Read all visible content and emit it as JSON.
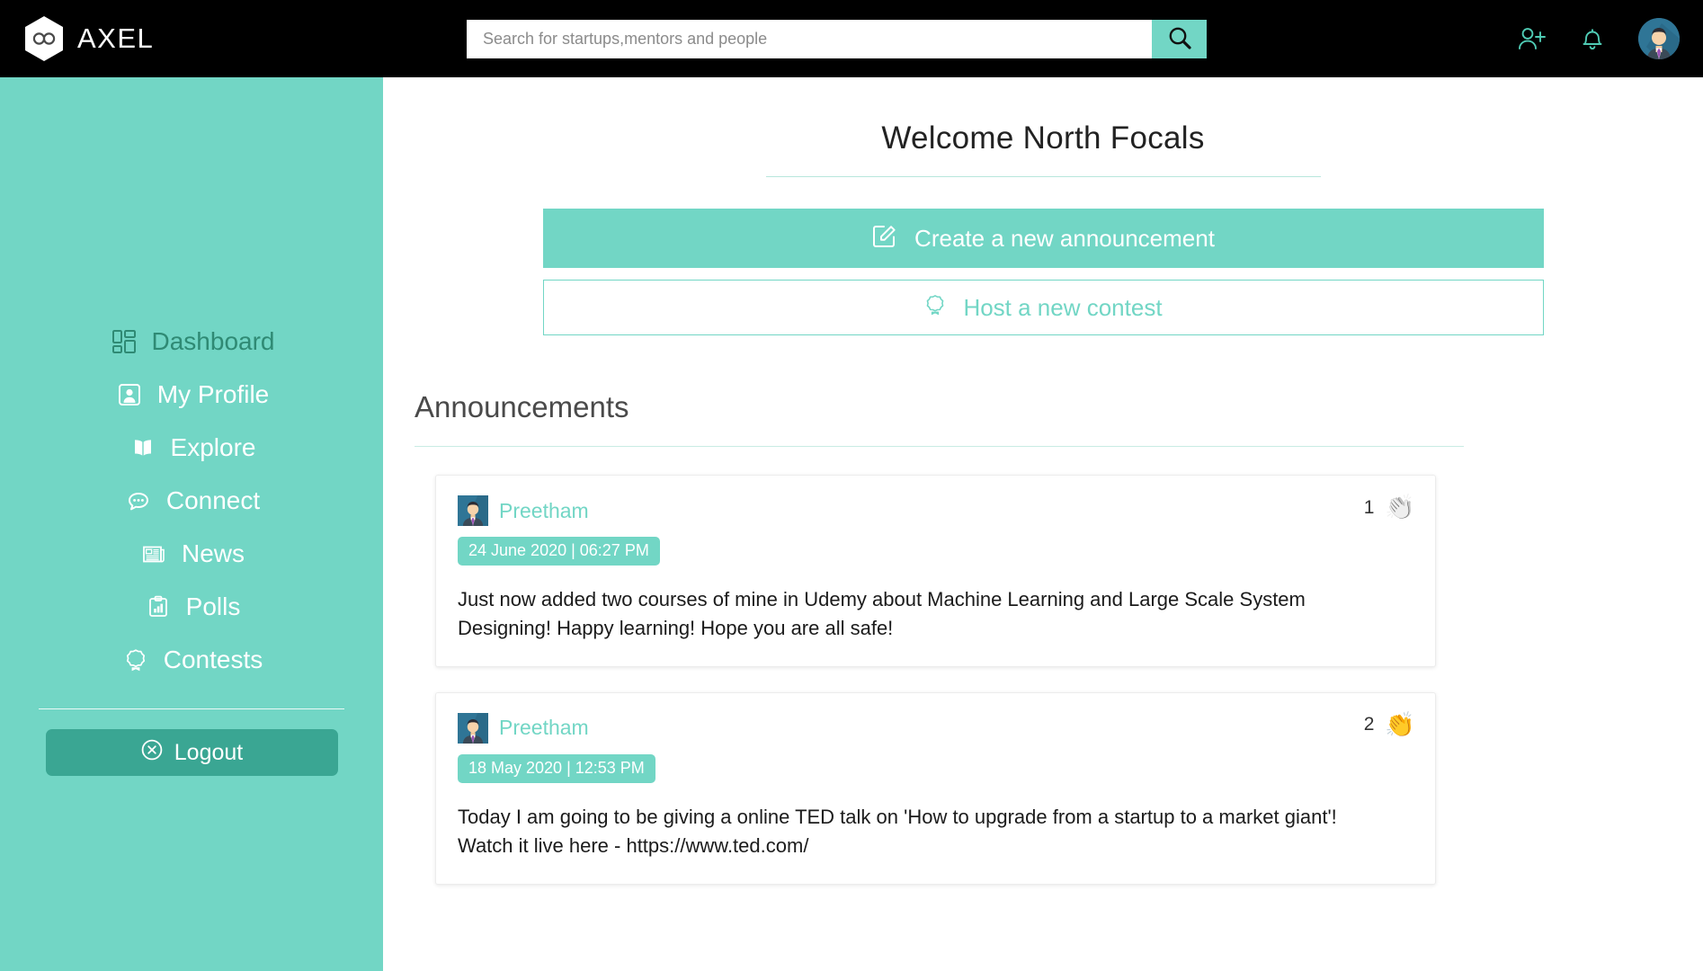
{
  "header": {
    "brand_name": "AXEL",
    "logo_icon": "infinity-hexagon-logo",
    "search": {
      "placeholder": "Search for startups,mentors and people",
      "value": "",
      "button_icon": "search-icon"
    },
    "icons": {
      "add_person": "add-person-icon",
      "notifications": "bell-icon",
      "avatar": "user-avatar"
    }
  },
  "sidebar": {
    "items": [
      {
        "label": "Dashboard",
        "icon": "dashboard-grid-icon",
        "active": true
      },
      {
        "label": "My Profile",
        "icon": "profile-card-icon",
        "active": false
      },
      {
        "label": "Explore",
        "icon": "open-book-icon",
        "active": false
      },
      {
        "label": "Connect",
        "icon": "chat-bubble-icon",
        "active": false
      },
      {
        "label": "News",
        "icon": "newspaper-icon",
        "active": false
      },
      {
        "label": "Polls",
        "icon": "poll-chart-icon",
        "active": false
      },
      {
        "label": "Contests",
        "icon": "award-badge-icon",
        "active": false
      }
    ],
    "logout": {
      "label": "Logout",
      "icon": "circle-x-icon"
    }
  },
  "main": {
    "welcome_title": "Welcome North Focals",
    "create_announcement": {
      "label": "Create a new announcement",
      "icon": "edit-square-icon"
    },
    "host_contest": {
      "label": "Host a new contest",
      "icon": "award-badge-icon"
    },
    "announcements_heading": "Announcements",
    "announcements": [
      {
        "author": "Preetham",
        "date": "24 June 2020 | 06:27 PM",
        "text": "Just now added two courses of mine in Udemy about Machine Learning and Large Scale System Designing! Happy learning! Hope you are all safe!",
        "clap_count": "1",
        "clap_icon": "clapping-hands-icon",
        "clapped": false
      },
      {
        "author": "Preetham",
        "date": "18 May 2020 | 12:53 PM",
        "text": "Today I am going to be giving a online TED talk on 'How to upgrade from a startup to a market giant'! Watch it live here - https://www.ted.com/",
        "clap_count": "2",
        "clap_icon": "clapping-hands-icon",
        "clapped": true
      }
    ]
  },
  "colors": {
    "accent_teal": "#72d6c5",
    "accent_teal_dark": "#3aa693",
    "active_nav": "#2f8a74",
    "topbar_black": "#000000",
    "rule_light": "#c9ece4"
  }
}
